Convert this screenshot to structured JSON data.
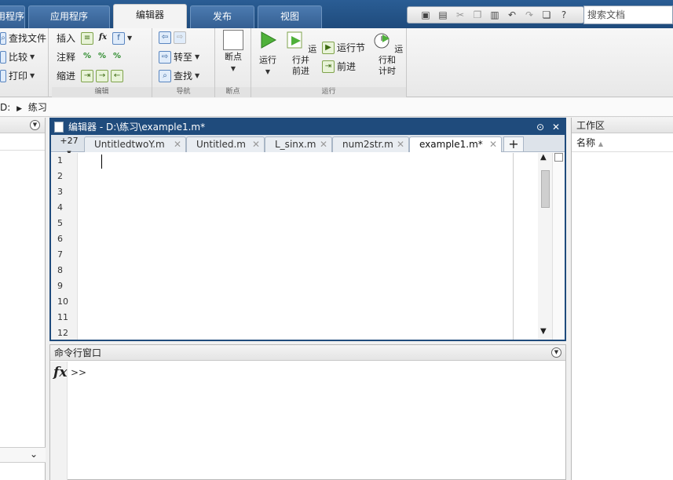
{
  "top_tabs": [
    "用程序",
    "应用程序",
    "编辑器",
    "发布",
    "视图"
  ],
  "active_tab": "编辑器",
  "search": {
    "placeholder": "搜索文档"
  },
  "ribbon": {
    "file": {
      "find_files": "查找文件",
      "compare": "比较",
      "print": "打印"
    },
    "edit": {
      "insert": "插入",
      "comment": "注释",
      "indent": "缩进",
      "label": "编辑"
    },
    "navigate": {
      "goto": "转至",
      "find": "查找",
      "label": "导航"
    },
    "breakpoints": {
      "breakpoints": "断点",
      "label": "断点"
    },
    "run": {
      "run": "运行",
      "run_advance_1": "运行并",
      "run_advance_2": "前进",
      "run_section": "运行节",
      "advance": "前进",
      "run_time_1": "运行和",
      "run_time_2": "计时",
      "label": "运行"
    }
  },
  "path": {
    "drive": "D:",
    "folder": "练习"
  },
  "editor": {
    "title": "编辑器 - D:\\练习\\example1.m*",
    "more_tabs": "+27",
    "tabs": [
      "UntitledtwoY.m",
      "Untitled.m",
      "L_sinx.m",
      "num2str.m",
      "example1.m*"
    ],
    "active_tab": "example1.m*",
    "line_numbers": [
      "1",
      "2",
      "3",
      "4",
      "5",
      "6",
      "7",
      "8",
      "9",
      "10",
      "11",
      "12"
    ]
  },
  "command_window": {
    "title": "命令行窗口",
    "fx": "fx",
    "prompt": ">>"
  },
  "workspace": {
    "title": "工作区",
    "name_column": "名称"
  }
}
